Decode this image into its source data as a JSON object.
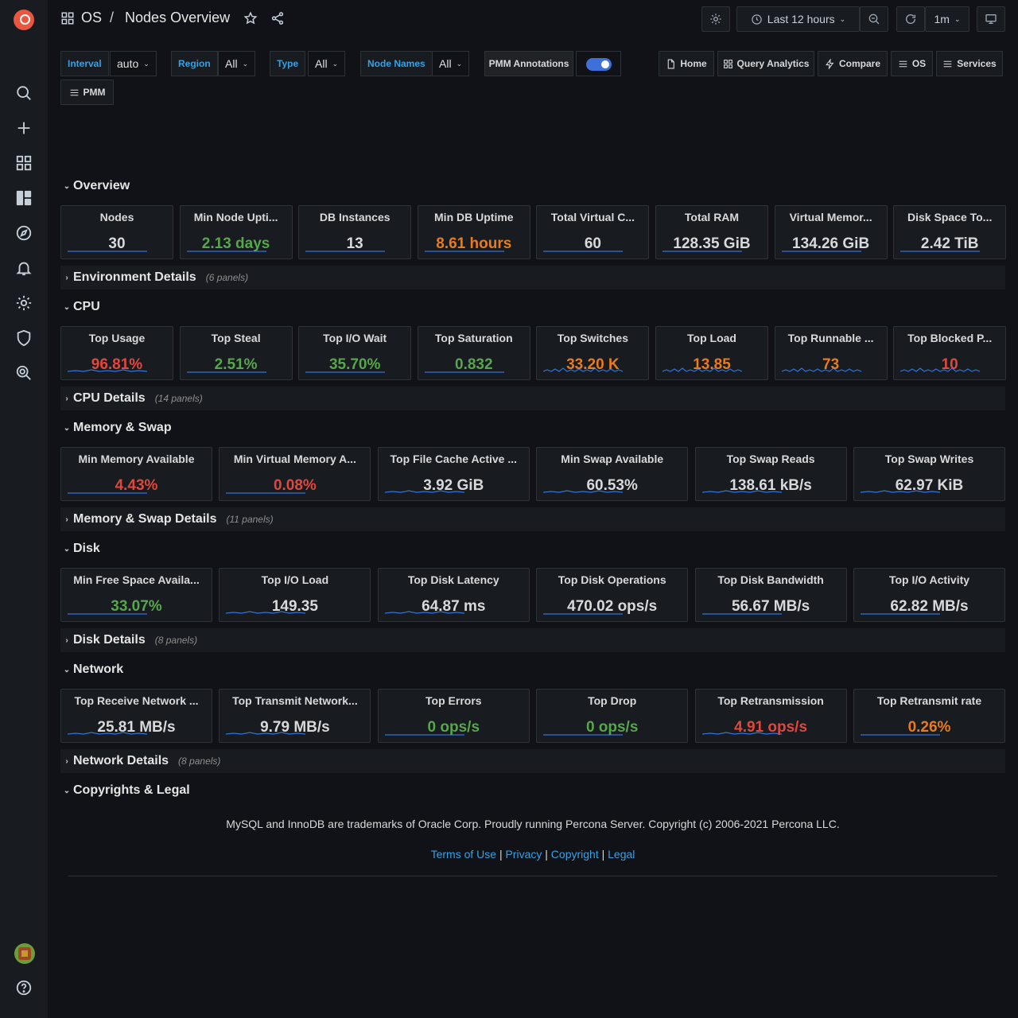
{
  "breadcrumb": {
    "folder": "OS",
    "separator": "/",
    "title": "Nodes Overview"
  },
  "toolbar": {
    "time_range": "Last 12 hours",
    "refresh_interval": "1m"
  },
  "variables": [
    {
      "label": "Interval",
      "value": "auto"
    },
    {
      "label": "Region",
      "value": "All"
    },
    {
      "label": "Type",
      "value": "All"
    },
    {
      "label": "Node Names",
      "value": "All"
    }
  ],
  "annotations": {
    "label": "PMM Annotations",
    "enabled": true
  },
  "links": [
    "Home",
    "Query Analytics",
    "Compare",
    "OS",
    "Services",
    "PMM"
  ],
  "rows": {
    "overview": "Overview",
    "env": {
      "title": "Environment Details",
      "count": "(6 panels)"
    },
    "cpu": "CPU",
    "cpu_details": {
      "title": "CPU Details",
      "count": "(14 panels)"
    },
    "memory": "Memory & Swap",
    "memory_details": {
      "title": "Memory & Swap Details",
      "count": "(11 panels)"
    },
    "disk": "Disk",
    "disk_details": {
      "title": "Disk Details",
      "count": "(8 panels)"
    },
    "network": "Network",
    "network_details": {
      "title": "Network Details",
      "count": "(8 panels)"
    },
    "legal": "Copyrights & Legal"
  },
  "panels": {
    "overview": [
      {
        "title": "Nodes",
        "value": "30",
        "color": "default"
      },
      {
        "title": "Min Node Upti...",
        "value": "2.13 days",
        "color": "green"
      },
      {
        "title": "DB Instances",
        "value": "13",
        "color": "default"
      },
      {
        "title": "Min DB Uptime",
        "value": "8.61 hours",
        "color": "orange"
      },
      {
        "title": "Total Virtual C...",
        "value": "60",
        "color": "default"
      },
      {
        "title": "Total RAM",
        "value": "128.35 GiB",
        "color": "default"
      },
      {
        "title": "Virtual Memor...",
        "value": "134.26 GiB",
        "color": "default"
      },
      {
        "title": "Disk Space To...",
        "value": "2.42 TiB",
        "color": "default"
      }
    ],
    "cpu": [
      {
        "title": "Top Usage",
        "value": "96.81%",
        "color": "red"
      },
      {
        "title": "Top Steal",
        "value": "2.51%",
        "color": "green"
      },
      {
        "title": "Top I/O Wait",
        "value": "35.70%",
        "color": "green"
      },
      {
        "title": "Top Saturation",
        "value": "0.832",
        "color": "green"
      },
      {
        "title": "Top Switches",
        "value": "33.20 K",
        "color": "orange"
      },
      {
        "title": "Top Load",
        "value": "13.85",
        "color": "orange"
      },
      {
        "title": "Top Runnable ...",
        "value": "73",
        "color": "orange"
      },
      {
        "title": "Top Blocked P...",
        "value": "10",
        "color": "red"
      }
    ],
    "memory": [
      {
        "title": "Min Memory Available",
        "value": "4.43%",
        "color": "red"
      },
      {
        "title": "Min Virtual Memory A...",
        "value": "0.08%",
        "color": "red"
      },
      {
        "title": "Top File Cache Active ...",
        "value": "3.92 GiB",
        "color": "default"
      },
      {
        "title": "Min Swap Available",
        "value": "60.53%",
        "color": "default"
      },
      {
        "title": "Top Swap Reads",
        "value": "138.61 kB/s",
        "color": "default"
      },
      {
        "title": "Top Swap Writes",
        "value": "62.97 KiB",
        "color": "default"
      }
    ],
    "disk": [
      {
        "title": "Min Free Space Availa...",
        "value": "33.07%",
        "color": "green"
      },
      {
        "title": "Top I/O Load",
        "value": "149.35",
        "color": "default"
      },
      {
        "title": "Top Disk Latency",
        "value": "64.87 ms",
        "color": "default"
      },
      {
        "title": "Top Disk Operations",
        "value": "470.02 ops/s",
        "color": "default"
      },
      {
        "title": "Top Disk Bandwidth",
        "value": "56.67 MB/s",
        "color": "default"
      },
      {
        "title": "Top I/O Activity",
        "value": "62.82 MB/s",
        "color": "default"
      }
    ],
    "network": [
      {
        "title": "Top Receive Network ...",
        "value": "25.81 MB/s",
        "color": "default"
      },
      {
        "title": "Top Transmit Network...",
        "value": "9.79 MB/s",
        "color": "default"
      },
      {
        "title": "Top Errors",
        "value": "0 ops/s",
        "color": "green"
      },
      {
        "title": "Top Drop",
        "value": "0 ops/s",
        "color": "green"
      },
      {
        "title": "Top Retransmission",
        "value": "4.91 ops/s",
        "color": "red"
      },
      {
        "title": "Top Retransmit rate",
        "value": "0.26%",
        "color": "orange"
      }
    ]
  },
  "footer": {
    "text": "MySQL and InnoDB are trademarks of Oracle Corp. Proudly running Percona Server. Copyright (c) 2006-2021 Percona LLC.",
    "links": [
      "Terms of Use",
      "Privacy",
      "Copyright",
      "Legal"
    ],
    "link_separator": "|"
  },
  "colors": {
    "accent": "#33a2e5",
    "green": "#56a64b",
    "red": "#e0483c",
    "orange": "#eb7b18",
    "spark": "#3274d9"
  }
}
